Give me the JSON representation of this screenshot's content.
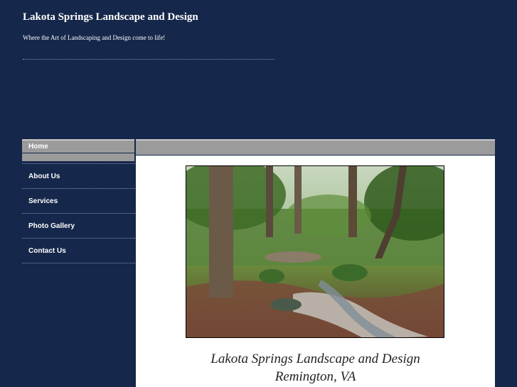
{
  "header": {
    "title": "Lakota Springs Landscape and Design",
    "tagline": "Where the Art of Landscaping and Design come to life!"
  },
  "nav": {
    "items": [
      {
        "label": "Home"
      },
      {
        "label": "About Us"
      },
      {
        "label": "Services"
      },
      {
        "label": "Photo Gallery"
      },
      {
        "label": "Contact Us"
      }
    ]
  },
  "content": {
    "caption_line1": "Lakota Springs Landscape and Design",
    "caption_line2": "Remington, VA"
  },
  "colors": {
    "background": "#15274a",
    "nav_highlight": "#9b9b9b",
    "content_bg": "#ffffff"
  }
}
